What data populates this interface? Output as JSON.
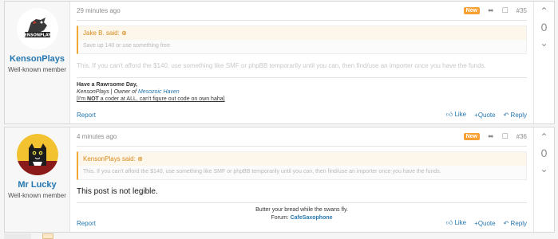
{
  "posts": [
    {
      "username": "KensonPlays",
      "usertitle": "Well-known member",
      "time": "29 minutes ago",
      "badge": "New",
      "post_number": "#35",
      "quote_author": "Jake B. said:",
      "quote_text": "Save up 140 or use something free",
      "body_text": "This. If you can't afford the $140, use something like SMF or phpBB temporarily until you can, then find/use an importer once you have the funds.",
      "sig_line1": "Have a Rawrsome Day,",
      "sig_name": "KensonPlays",
      "sig_sep": " | ",
      "sig_role_prefix": "Owner of ",
      "sig_site": "Mesozoic Haven",
      "sig_note_a": "I'm ",
      "sig_note_not": "NOT",
      "sig_note_b": " a coder at ALL, can't figure out code on own haha",
      "report": "Report",
      "like": "Like",
      "quote": "Quote",
      "reply": "Reply",
      "score": "0"
    },
    {
      "username": "Mr Lucky",
      "usertitle": "Well-known member",
      "time": "4 minutes ago",
      "badge": "New",
      "post_number": "#36",
      "quote_author": "KensonPlays said:",
      "quote_text": "This. If you can't afford the $140, use something like SMF or phpBB temporarily until you can, then find/use an importer once you have the funds.",
      "body_text": "This post is not legible.",
      "sig_line1": "Butter your bread while the swans fly.",
      "sig_forum_label": "Forum: ",
      "sig_forum_link": "CafeSaxophone",
      "report": "Report",
      "like": "Like",
      "quote": "Quote",
      "reply": "Reply",
      "score": "0"
    }
  ],
  "icons": {
    "up": "up-arrow-icon",
    "down": "down-arrow-icon",
    "share": "share-icon",
    "bookmark": "bookmark-icon",
    "like": "thumbs-up-icon",
    "quote": "plus-icon",
    "reply": "reply-icon",
    "quote_expand": "circle-arrow-icon"
  },
  "colors": {
    "link": "#2577b1",
    "badge": "#f7a133",
    "quote_accent": "#f0a733"
  }
}
